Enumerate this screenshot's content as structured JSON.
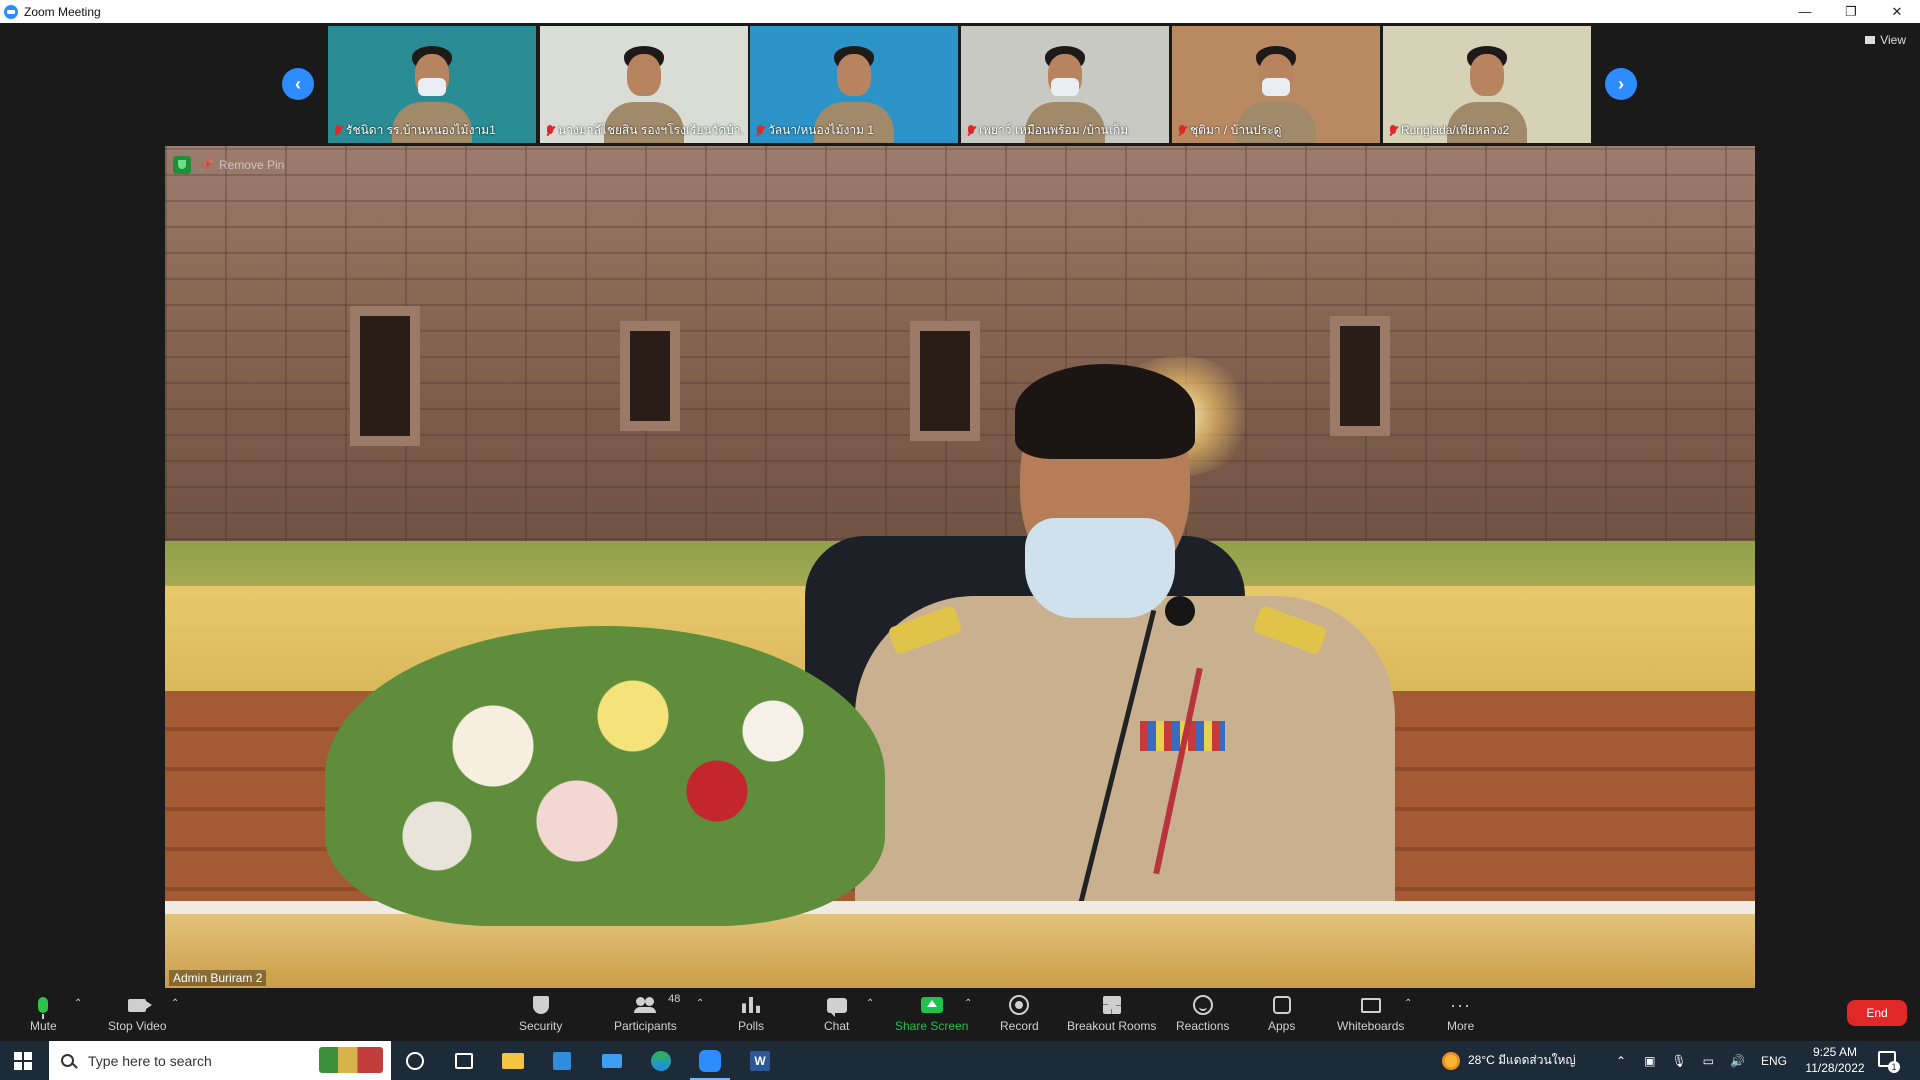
{
  "window": {
    "title": "Zoom Meeting",
    "controls": {
      "minimize": "—",
      "restore": "❐",
      "close": "✕"
    }
  },
  "view_button": {
    "label": "View"
  },
  "thumbnails": [
    {
      "name": "รัชนิดา รร.บ้านหนองไม้งาม1",
      "bg": "#2a8c94",
      "muted": true
    },
    {
      "name": "นางมาลีไชยสิน รองฯโรงเรียนวัดบ้า...",
      "bg": "#d9ddd6",
      "muted": true
    },
    {
      "name": "วัลนา/หนองไม้งาม 1",
      "bg": "#2c93c9",
      "muted": true
    },
    {
      "name": "เพยาว์ เหมือนพร้อม /บ้านเก็ม",
      "bg": "#c9c9c4",
      "muted": true
    },
    {
      "name": "ชุติมา / บ้านประดู่",
      "bg": "#b98a62",
      "muted": true
    },
    {
      "name": "Runglada/เพียหลวง2",
      "bg": "#d6d2b8",
      "muted": true
    }
  ],
  "main_video": {
    "participant": "Admin Buriram 2",
    "remove_pin": "Remove Pin"
  },
  "controls": {
    "mute": "Mute",
    "stop_video": "Stop Video",
    "security": "Security",
    "participants": "Participants",
    "participants_count": "48",
    "polls": "Polls",
    "chat": "Chat",
    "share_screen": "Share Screen",
    "record": "Record",
    "breakout_rooms": "Breakout Rooms",
    "reactions": "Reactions",
    "apps": "Apps",
    "whiteboards": "Whiteboards",
    "more": "More",
    "end": "End"
  },
  "taskbar": {
    "search_placeholder": "Type here to search",
    "weather": "28°C มีแดดส่วนใหญ่",
    "language": "ENG",
    "time": "9:25 AM",
    "date": "11/28/2022",
    "notifications": "1"
  },
  "colors": {
    "accent": "#2d8cff",
    "end": "#e02828",
    "share": "#1dc34a",
    "muted": "#e02828"
  }
}
